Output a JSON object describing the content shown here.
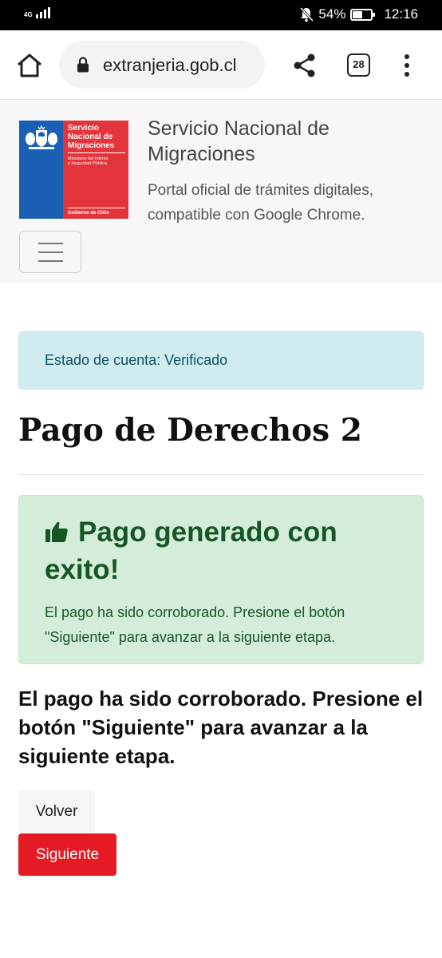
{
  "status_bar": {
    "network": "4G",
    "battery_percent": "54%",
    "battery_level": 0.54,
    "time": "12:16"
  },
  "browser": {
    "url": "extranjeria.gob.cl",
    "tab_count": "28",
    "icons": [
      "home-icon",
      "lock-icon",
      "share-icon",
      "tabs-icon",
      "more-vert-icon"
    ]
  },
  "header": {
    "logo": {
      "line1": "Servicio",
      "line2": "Nacional de",
      "line3": "Migraciones",
      "ministry1": "Ministerio del Interior",
      "ministry2": "y Seguridad Pública",
      "gov": "Gobierno de Chile"
    },
    "title": "Servicio Nacional de Migraciones",
    "subtitle": "Portal oficial de trámites digitales, compatible con Google Chrome."
  },
  "content": {
    "account_status": "Estado de cuenta: Verificado",
    "page_title": "Pago de Derechos 2",
    "success_heading": "Pago generado con exito!",
    "success_text": "El pago ha sido corroborado. Presione el botón \"Siguiente\" para avanzar a la siguiente etapa.",
    "big_text": "El pago ha sido corroborado. Presione el botón \"Siguiente\" para avanzar a la siguiente etapa."
  },
  "buttons": {
    "back": "Volver",
    "next": "Siguiente"
  },
  "colors": {
    "primary_red": "#e41b23",
    "info_bg": "#d1ecf1",
    "success_bg": "#d4edda",
    "success_text": "#155724",
    "logo_blue": "#1a5fb4",
    "logo_red": "#e4343b"
  }
}
